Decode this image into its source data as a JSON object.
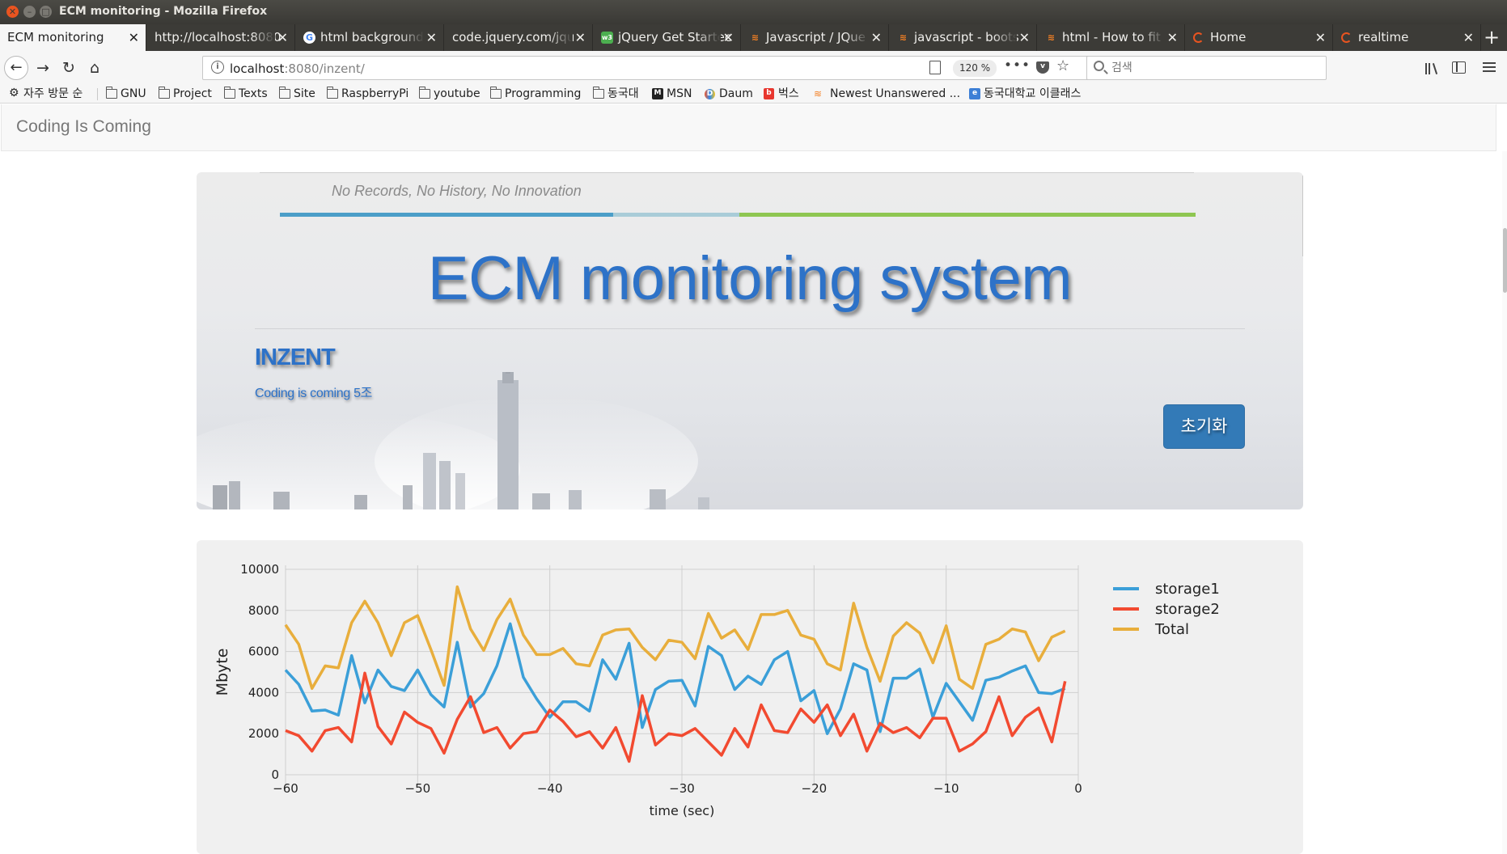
{
  "window": {
    "title": "ECM monitoring - Mozilla Firefox"
  },
  "tabs": [
    {
      "label": "ECM monitoring",
      "icon": "none",
      "active": true
    },
    {
      "label": "http://localhost:8080",
      "icon": "none",
      "active": false
    },
    {
      "label": "html background",
      "icon": "google-icon",
      "active": false
    },
    {
      "label": "code.jquery.com/jqu",
      "icon": "none",
      "active": false
    },
    {
      "label": "jQuery Get Startec",
      "icon": "w3schools-icon",
      "active": false
    },
    {
      "label": "Javascript / JQue",
      "icon": "stackoverflow-icon",
      "active": false
    },
    {
      "label": "javascript - boots",
      "icon": "stackoverflow-icon",
      "active": false
    },
    {
      "label": "html - How to fit",
      "icon": "stackoverflow-icon",
      "active": false
    },
    {
      "label": "Home",
      "icon": "loading-icon",
      "active": false
    },
    {
      "label": "realtime",
      "icon": "loading-icon",
      "active": false
    }
  ],
  "newtab": {
    "label": "+"
  },
  "navbar": {
    "url_host": "localhost",
    "url_rest": ":8080/inzent/",
    "zoom": "120 %",
    "search_placeholder": "검색"
  },
  "bookmarks": [
    {
      "label": "자주 방문 순",
      "icon": "gear-icon"
    },
    {
      "label": "GNU",
      "icon": "folder-icon"
    },
    {
      "label": "Project",
      "icon": "folder-icon"
    },
    {
      "label": "Texts",
      "icon": "folder-icon"
    },
    {
      "label": "Site",
      "icon": "folder-icon"
    },
    {
      "label": "RaspberryPi",
      "icon": "folder-icon"
    },
    {
      "label": "youtube",
      "icon": "folder-icon"
    },
    {
      "label": "Programming",
      "icon": "folder-icon"
    },
    {
      "label": "동국대",
      "icon": "folder-icon"
    },
    {
      "label": "MSN",
      "icon": "msn-icon"
    },
    {
      "label": "Daum",
      "icon": "daum-icon"
    },
    {
      "label": "벅스",
      "icon": "bugs-icon"
    },
    {
      "label": "Newest Unanswered ...",
      "icon": "stackoverflow-icon"
    },
    {
      "label": "동국대학교 이클래스",
      "icon": "eclass-icon"
    }
  ],
  "page": {
    "brand": "Coding Is Coming",
    "tagline": "No Records, No History, No Innovation",
    "title": "ECM monitoring system",
    "team": "INZENT",
    "team_sub": "Coding is coming 5조",
    "reset_button": "초기화"
  },
  "colors": {
    "storage1": "#3b9fd8",
    "storage2": "#f24a30",
    "total": "#e8ae3c",
    "accent_blue": "#2d72c8"
  },
  "chart_data": {
    "type": "line",
    "title": "",
    "xlabel": "time (sec)",
    "ylabel": "Mbyte",
    "xlim": [
      -60,
      0
    ],
    "ylim": [
      0,
      10000
    ],
    "xticks": [
      -60,
      -50,
      -40,
      -30,
      -20,
      -10,
      0
    ],
    "xtick_labels": [
      "−60",
      "−50",
      "−40",
      "−30",
      "−20",
      "−10",
      "0"
    ],
    "yticks": [
      0,
      2000,
      4000,
      6000,
      8000,
      10000
    ],
    "ytick_labels": [
      "0",
      "2000",
      "4000",
      "6000",
      "8000",
      "10000"
    ],
    "grid": true,
    "legend_position": "top-right",
    "x": [
      -60,
      -59,
      -58,
      -57,
      -56,
      -55,
      -54,
      -53,
      -52,
      -51,
      -50,
      -49,
      -48,
      -47,
      -46,
      -45,
      -44,
      -43,
      -42,
      -41,
      -40,
      -39,
      -38,
      -37,
      -36,
      -35,
      -34,
      -33,
      -32,
      -31,
      -30,
      -29,
      -28,
      -27,
      -26,
      -25,
      -24,
      -23,
      -22,
      -21,
      -20,
      -19,
      -18,
      -17,
      -16,
      -15,
      -14,
      -13,
      -12,
      -11,
      -10,
      -9,
      -8,
      -7,
      -6,
      -5,
      -4,
      -3,
      -2,
      -1
    ],
    "series": [
      {
        "name": "storage1",
        "color": "#3b9fd8",
        "values": [
          5100,
          4400,
          3100,
          3150,
          2900,
          5800,
          3500,
          5100,
          4300,
          4100,
          5100,
          3900,
          3300,
          6450,
          3300,
          3950,
          5300,
          7350,
          4750,
          3700,
          2800,
          3550,
          3550,
          3100,
          5600,
          4650,
          6400,
          2300,
          4150,
          4550,
          4600,
          3350,
          6250,
          5800,
          4150,
          4800,
          4400,
          5600,
          6000,
          3600,
          4100,
          2000,
          3200,
          5400,
          5100,
          2100,
          4700,
          4700,
          5150,
          2800,
          4450,
          3550,
          2650,
          4600,
          4750,
          5050,
          5300,
          4000,
          3950,
          4200
        ]
      },
      {
        "name": "storage2",
        "color": "#f24a30",
        "values": [
          2150,
          1900,
          1150,
          2150,
          2300,
          1600,
          4950,
          2350,
          1500,
          3050,
          2550,
          2250,
          1050,
          2700,
          3800,
          2050,
          2300,
          1300,
          2000,
          2100,
          3150,
          2600,
          1850,
          2100,
          1300,
          2300,
          650,
          3850,
          1450,
          2000,
          1900,
          2250,
          1600,
          950,
          2250,
          1350,
          3400,
          2150,
          2050,
          3200,
          2550,
          3400,
          1900,
          2950,
          1150,
          2500,
          2050,
          2300,
          1800,
          2750,
          2750,
          1150,
          1500,
          2100,
          3800,
          1900,
          2800,
          3250,
          1600,
          4550
        ]
      },
      {
        "name": "Total",
        "color": "#e8ae3c",
        "values": [
          7300,
          6350,
          4200,
          5300,
          5200,
          7400,
          8450,
          7400,
          5800,
          7400,
          7750,
          6100,
          4350,
          9150,
          7100,
          6050,
          7550,
          8550,
          6800,
          5850,
          5850,
          6150,
          5400,
          5300,
          6800,
          7050,
          7100,
          6200,
          5600,
          6550,
          6450,
          5650,
          7850,
          6650,
          7050,
          6100,
          7800,
          7800,
          8000,
          6800,
          6600,
          5400,
          5100,
          8350,
          6200,
          4550,
          6750,
          7400,
          6900,
          5450,
          7250,
          4650,
          4200,
          6350,
          6600,
          7100,
          6950,
          5550,
          6700,
          7000
        ]
      }
    ]
  }
}
